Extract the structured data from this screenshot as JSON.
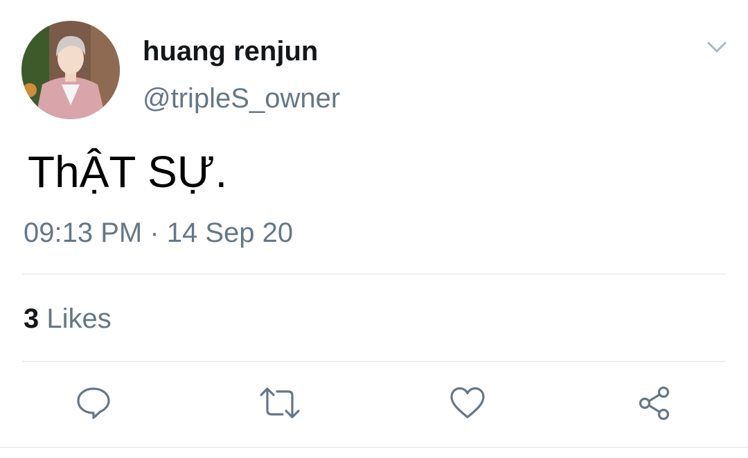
{
  "user": {
    "display_name": "huang renjun",
    "handle": "@tripleS_owner"
  },
  "tweet": {
    "text": "ThẬT SỰ.",
    "time": "09:13 PM",
    "separator": "·",
    "date": "14 Sep 20",
    "timestamp": "09:13 PM · 14 Sep 20"
  },
  "stats": {
    "likes_count": "3",
    "likes_label": "Likes"
  },
  "actions": [
    {
      "name": "reply",
      "icon": "reply-icon"
    },
    {
      "name": "retweet",
      "icon": "retweet-icon"
    },
    {
      "name": "like",
      "icon": "heart-icon"
    },
    {
      "name": "share",
      "icon": "share-icon"
    }
  ],
  "colors": {
    "primary_text": "#14171a",
    "secondary_text": "#657786",
    "divider": "#dfe3e7",
    "icon": "#657786"
  }
}
